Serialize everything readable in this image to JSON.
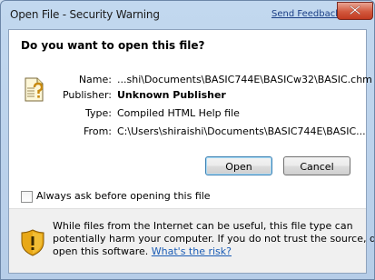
{
  "window": {
    "title": "Open File - Security Warning",
    "feedback_link": "Send Feedback"
  },
  "dialog": {
    "heading": "Do you want to open this file?",
    "fields": [
      {
        "label": "Name:",
        "value": "...shi\\Documents\\BASIC744E\\BASICw32\\BASIC.chm"
      },
      {
        "label": "Publisher:",
        "value": "Unknown Publisher"
      },
      {
        "label": "Type:",
        "value": "Compiled HTML Help file"
      },
      {
        "label": "From:",
        "value": "C:\\Users\\shiraishi\\Documents\\BASIC744E\\BASIC..."
      }
    ],
    "open_button": "Open",
    "cancel_button": "Cancel",
    "checkbox_label": "Always ask before opening this file",
    "checkbox_checked": false
  },
  "warning": {
    "line1": "While files from the Internet can be useful, this file type can",
    "line2": "potentially harm your computer. If you do not trust the source, do not",
    "line3_prefix": "open this software.",
    "risk_link": "What's the risk?"
  },
  "icons": {
    "file": "document-question-icon",
    "shield": "warning-shield-icon",
    "close": "close-icon"
  },
  "colors": {
    "link": "#1a5cb5",
    "shield": "#e8a817",
    "close_button": "#c13a20"
  }
}
